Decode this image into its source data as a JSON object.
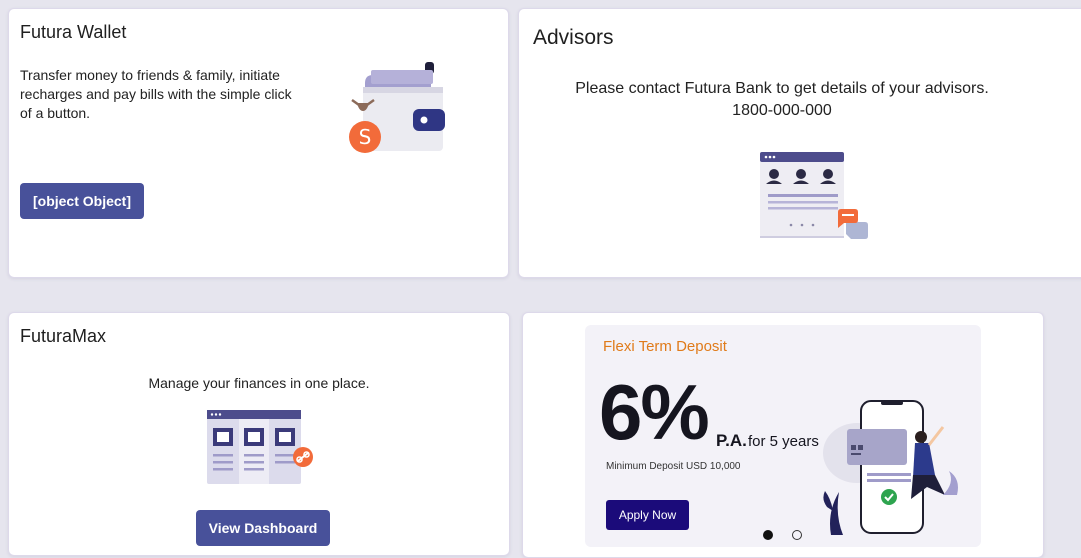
{
  "wallet": {
    "title": "Futura Wallet",
    "description": "Transfer money to friends & family, initiate recharges and pay bills with the simple click of a button.",
    "button_label": "[object Object]",
    "illustration": "wallet-icon"
  },
  "advisors": {
    "title": "Advisors",
    "message": "Please contact Futura Bank to get details of your advisors.",
    "phone": "1800-000-000",
    "illustration": "advisors-icon"
  },
  "futuramax": {
    "title": "FuturaMax",
    "description": "Manage your finances in one place.",
    "button_label": "View Dashboard",
    "illustration": "dashboard-link-icon"
  },
  "promo": {
    "heading": "Flexi Term Deposit",
    "rate": "6%",
    "rate_unit": "P.A.",
    "period": "for 5 years",
    "minimum": "Minimum Deposit USD 10,000",
    "button_label": "Apply Now",
    "illustration": "phone-payment-icon",
    "slides": {
      "current": 1,
      "total": 2
    }
  },
  "colors": {
    "primary_button": "#48519a",
    "apply_button": "#1b0b7a",
    "promo_heading": "#e07b1a",
    "accent_orange": "#f26b3a",
    "page_background": "#e6e5ee"
  }
}
